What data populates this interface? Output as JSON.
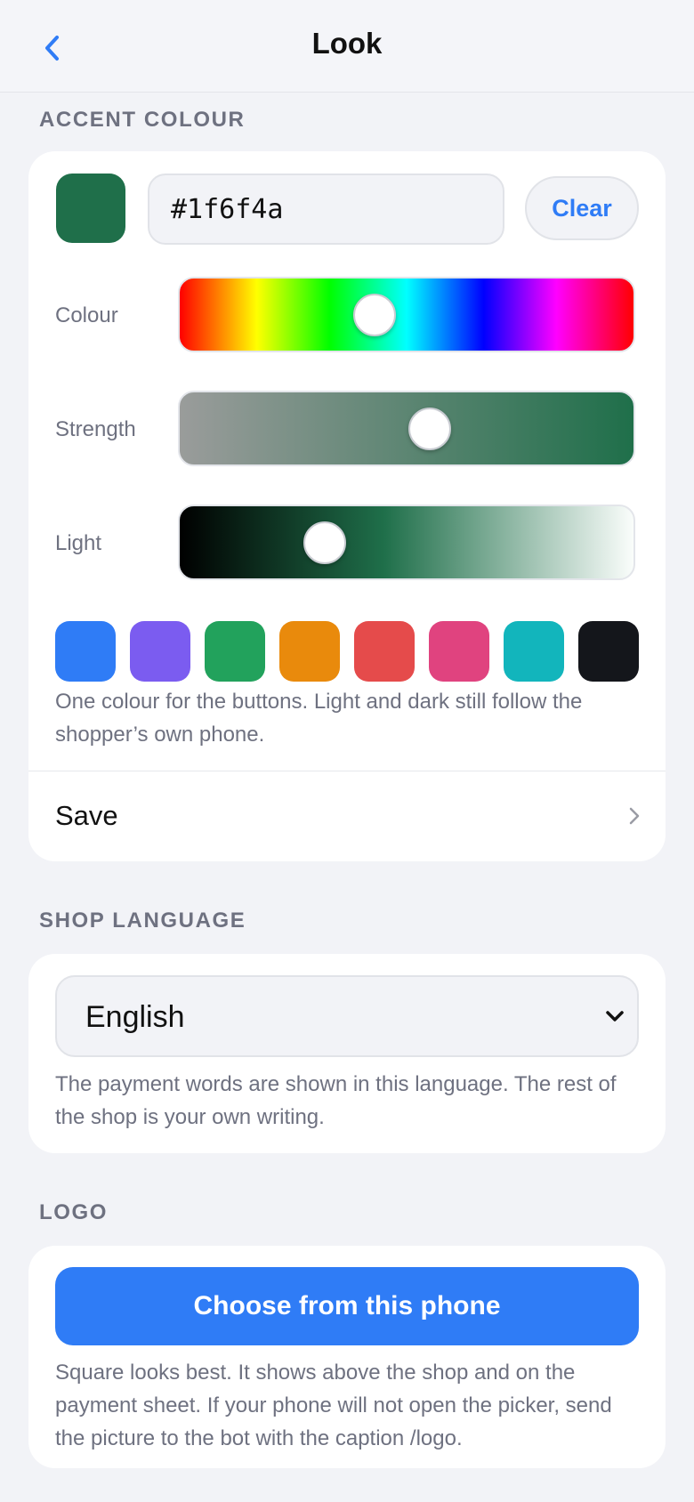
{
  "header": {
    "title": "Look"
  },
  "accent": {
    "section_label": "ACCENT COLOUR",
    "hex_value": "#1f6f4a",
    "swatch_color": "#1f6f4a",
    "clear_label": "Clear",
    "sliders": {
      "colour": {
        "label": "Colour",
        "value": 0.43
      },
      "strength": {
        "label": "Strength",
        "value": 0.55
      },
      "light": {
        "label": "Light",
        "value": 0.32
      }
    },
    "presets": [
      "#2f7cf6",
      "#7b5cf0",
      "#22a25c",
      "#e98a0c",
      "#e54b4b",
      "#e0437f",
      "#12b5bc",
      "#14161b"
    ],
    "help": "One colour for the buttons. Light and dark still follow the shopper’s own phone.",
    "save_label": "Save"
  },
  "language": {
    "section_label": "SHOP LANGUAGE",
    "selected": "English",
    "help": "The payment words are shown in this language. The rest of the shop is your own writing."
  },
  "logo": {
    "section_label": "LOGO",
    "button_label": "Choose from this phone",
    "help": "Square looks best. It shows above the shop and on the payment sheet. If your phone will not open the picker, send the picture to the bot with the caption /logo."
  },
  "colors": {
    "accent": "#2f7cf6",
    "muted": "#6e7180"
  }
}
